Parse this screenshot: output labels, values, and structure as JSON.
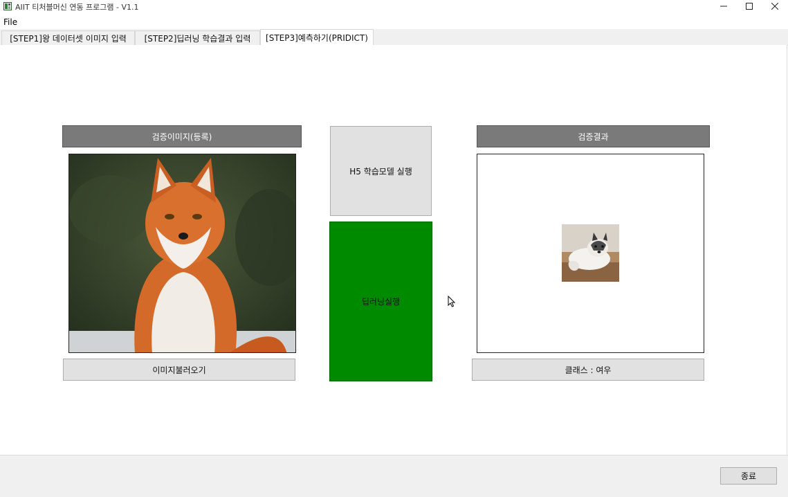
{
  "window": {
    "title": "AIIT 티처블머신 연동 프로그램 - V1.1",
    "controls": {
      "minimize": "—",
      "maximize": "☐",
      "close": "✕"
    }
  },
  "menu": {
    "file": "File"
  },
  "tabs": [
    {
      "label": "[STEP1]왕 데이터셋 이미지 입력",
      "active": false
    },
    {
      "label": "[STEP2]딥러닝 학습결과 입력",
      "active": false
    },
    {
      "label": "[STEP3]예측하기(PRIDICT)",
      "active": true
    }
  ],
  "left": {
    "header": "검증이미지(등록)",
    "image_icon": "red-fox-photo",
    "load_button": "이미지불러오기"
  },
  "middle": {
    "run_model_button": "H5 학습모델 실행",
    "deep_run_button": "딥러닝실행"
  },
  "right": {
    "header": "검증결과",
    "image_icon": "arctic-fox-photo",
    "class_result": "클래스 : 여우"
  },
  "footer": {
    "exit_button": "종료"
  },
  "colors": {
    "header_bar": "#7a7a7a",
    "deep_run": "#008a00",
    "button": "#e1e1e1"
  }
}
